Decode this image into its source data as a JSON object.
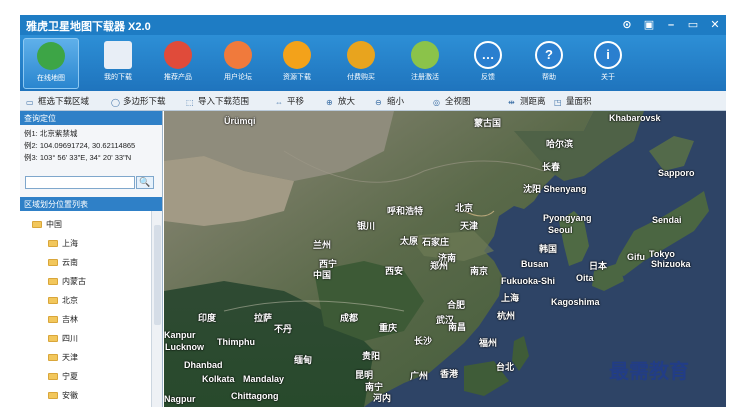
{
  "app": {
    "title": "雅虎卫星地图下载器 X2.0",
    "window_buttons": [
      "⊙",
      "▣",
      "–",
      "▭",
      "✕"
    ]
  },
  "ribbon": [
    {
      "label": "在线地图",
      "icon": "globe-icon",
      "color": "#3da546"
    },
    {
      "label": "我的下载",
      "icon": "downloads-icon",
      "color": "#e8eef6"
    },
    {
      "label": "推荐产品",
      "icon": "products-icon",
      "color": "#e04b3a"
    },
    {
      "label": "用户论坛",
      "icon": "forum-icon",
      "color": "#f07a3c"
    },
    {
      "label": "资源下载",
      "icon": "resources-icon",
      "color": "#f3a21a"
    },
    {
      "label": "付费购买",
      "icon": "cart-icon",
      "color": "#e8a41e"
    },
    {
      "label": "注册激活",
      "icon": "register-icon",
      "color": "#8bc34a"
    },
    {
      "label": "反馈",
      "icon": "feedback-icon",
      "color": "#2a7fcf"
    },
    {
      "label": "帮助",
      "icon": "help-icon",
      "color": "#2a7fcf"
    },
    {
      "label": "关于",
      "icon": "about-icon",
      "color": "#2a7fcf"
    }
  ],
  "toolbar": [
    {
      "label": "框选下载区域",
      "icon": "rect-select-icon"
    },
    {
      "label": "多边形下载",
      "icon": "polygon-icon"
    },
    {
      "label": "导入下载范围",
      "icon": "import-icon"
    },
    {
      "label": "平移",
      "icon": "pan-icon"
    },
    {
      "label": "放大",
      "icon": "zoom-in-icon"
    },
    {
      "label": "缩小",
      "icon": "zoom-out-icon"
    },
    {
      "label": "全视图",
      "icon": "full-view-icon"
    },
    {
      "label": "测距离",
      "icon": "ruler-icon"
    },
    {
      "label": "量面积",
      "icon": "area-icon"
    }
  ],
  "search": {
    "header": "查询定位",
    "examples": [
      "例1: 北京紫禁城",
      "例2: 104.09691724, 30.62114865",
      "例3: 103° 56' 33\"E, 34° 20' 33\"N"
    ],
    "value": "",
    "button": "🔍"
  },
  "regions": {
    "header": "区域划分位置列表",
    "root": "中国",
    "items": [
      "上海",
      "云南",
      "内蒙古",
      "北京",
      "吉林",
      "四川",
      "天津",
      "宁夏",
      "安徽"
    ]
  },
  "map": {
    "labels": [
      {
        "t": "Khabarovsk",
        "lang": "en"
      },
      {
        "t": "哈尔滨",
        "lang": "cn"
      },
      {
        "t": "长春",
        "lang": "cn"
      },
      {
        "t": "沈阳 Shenyang",
        "lang": "en"
      },
      {
        "t": "Sapporo",
        "lang": "en"
      },
      {
        "t": "呼和浩特",
        "lang": "cn"
      },
      {
        "t": "北京",
        "lang": "cn"
      },
      {
        "t": "天津",
        "lang": "cn"
      },
      {
        "t": "Pyongyang",
        "lang": "en"
      },
      {
        "t": "Seoul",
        "lang": "en"
      },
      {
        "t": "韩国",
        "lang": "cn"
      },
      {
        "t": "Sendai",
        "lang": "en"
      },
      {
        "t": "Busan",
        "lang": "en"
      },
      {
        "t": "日本",
        "lang": "cn"
      },
      {
        "t": "Tokyo",
        "lang": "en"
      },
      {
        "t": "Gifu",
        "lang": "en"
      },
      {
        "t": "Shizuoka",
        "lang": "en"
      },
      {
        "t": "Fukuoka-Shi",
        "lang": "en"
      },
      {
        "t": "Oita",
        "lang": "en"
      },
      {
        "t": "Kagoshima",
        "lang": "en"
      },
      {
        "t": "银川",
        "lang": "cn"
      },
      {
        "t": "太原",
        "lang": "cn"
      },
      {
        "t": "石家庄",
        "lang": "cn"
      },
      {
        "t": "济南",
        "lang": "cn"
      },
      {
        "t": "兰州",
        "lang": "cn"
      },
      {
        "t": "西宁",
        "lang": "cn"
      },
      {
        "t": "郑州",
        "lang": "cn"
      },
      {
        "t": "西安",
        "lang": "cn"
      },
      {
        "t": "中国",
        "lang": "cn"
      },
      {
        "t": "南京",
        "lang": "cn"
      },
      {
        "t": "上海",
        "lang": "cn"
      },
      {
        "t": "合肥",
        "lang": "cn"
      },
      {
        "t": "武汉",
        "lang": "cn"
      },
      {
        "t": "杭州",
        "lang": "cn"
      },
      {
        "t": "成都",
        "lang": "cn"
      },
      {
        "t": "重庆",
        "lang": "cn"
      },
      {
        "t": "长沙",
        "lang": "cn"
      },
      {
        "t": "南昌",
        "lang": "cn"
      },
      {
        "t": "福州",
        "lang": "cn"
      },
      {
        "t": "台北",
        "lang": "cn"
      },
      {
        "t": "贵阳",
        "lang": "cn"
      },
      {
        "t": "昆明",
        "lang": "cn"
      },
      {
        "t": "南宁",
        "lang": "cn"
      },
      {
        "t": "广州",
        "lang": "cn"
      },
      {
        "t": "香港",
        "lang": "cn"
      },
      {
        "t": "河内",
        "lang": "cn"
      },
      {
        "t": "Lucknow",
        "lang": "en"
      },
      {
        "t": "Thimphu",
        "lang": "en"
      },
      {
        "t": "Dhanbad",
        "lang": "en"
      },
      {
        "t": "Kolkata",
        "lang": "en"
      },
      {
        "t": "Chittagong",
        "lang": "en"
      },
      {
        "t": "Mandalay",
        "lang": "en"
      },
      {
        "t": "Nagpur",
        "lang": "en"
      },
      {
        "t": "Kanpur",
        "lang": "en"
      },
      {
        "t": "拉萨",
        "lang": "cn"
      },
      {
        "t": "不丹",
        "lang": "cn"
      },
      {
        "t": "印度",
        "lang": "cn"
      },
      {
        "t": "缅甸",
        "lang": "cn"
      },
      {
        "t": "Ürümqi",
        "lang": "en"
      },
      {
        "t": "蒙古国",
        "lang": "cn"
      }
    ]
  },
  "watermark": "最需教育"
}
